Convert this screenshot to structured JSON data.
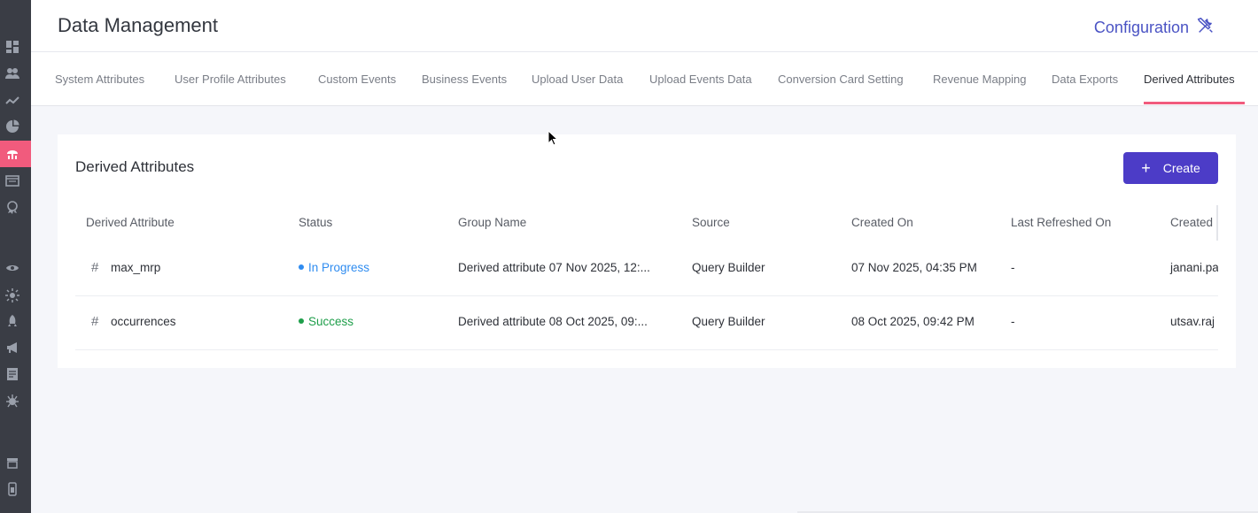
{
  "header": {
    "title": "Data Management",
    "config_label": "Configuration"
  },
  "tabs": [
    {
      "label": "System Attributes"
    },
    {
      "label": "User Profile Attributes"
    },
    {
      "label": "Custom Events"
    },
    {
      "label": "Business Events"
    },
    {
      "label": "Upload User Data"
    },
    {
      "label": "Upload Events Data"
    },
    {
      "label": "Conversion Card Setting"
    },
    {
      "label": "Revenue Mapping"
    },
    {
      "label": "Data Exports"
    },
    {
      "label": "Derived Attributes",
      "active": true
    }
  ],
  "card": {
    "title": "Derived Attributes",
    "create_label": "Create"
  },
  "table": {
    "columns": [
      "Derived Attribute",
      "Status",
      "Group Name",
      "Source",
      "Created On",
      "Last Refreshed On",
      "Created"
    ],
    "rows": [
      {
        "name": "max_mrp",
        "status": "In Progress",
        "status_color": "#2f8cf0",
        "group": "Derived attribute 07 Nov 2025, 12:...",
        "source": "Query Builder",
        "created_on": "07 Nov 2025, 04:35 PM",
        "last_refreshed": "-",
        "created_by": "janani.pa"
      },
      {
        "name": "occurrences",
        "status": "Success",
        "status_color": "#1e9e4a",
        "group": "Derived attribute 08 Oct 2025, 09:...",
        "source": "Query Builder",
        "created_on": "08 Oct 2025, 09:42 PM",
        "last_refreshed": "-",
        "created_by": "utsav.raj"
      }
    ]
  },
  "colors": {
    "accent": "#f15b7d",
    "primary_button": "#4c3cc7",
    "link": "#4a53c4",
    "sidebar": "#3a3d45"
  }
}
